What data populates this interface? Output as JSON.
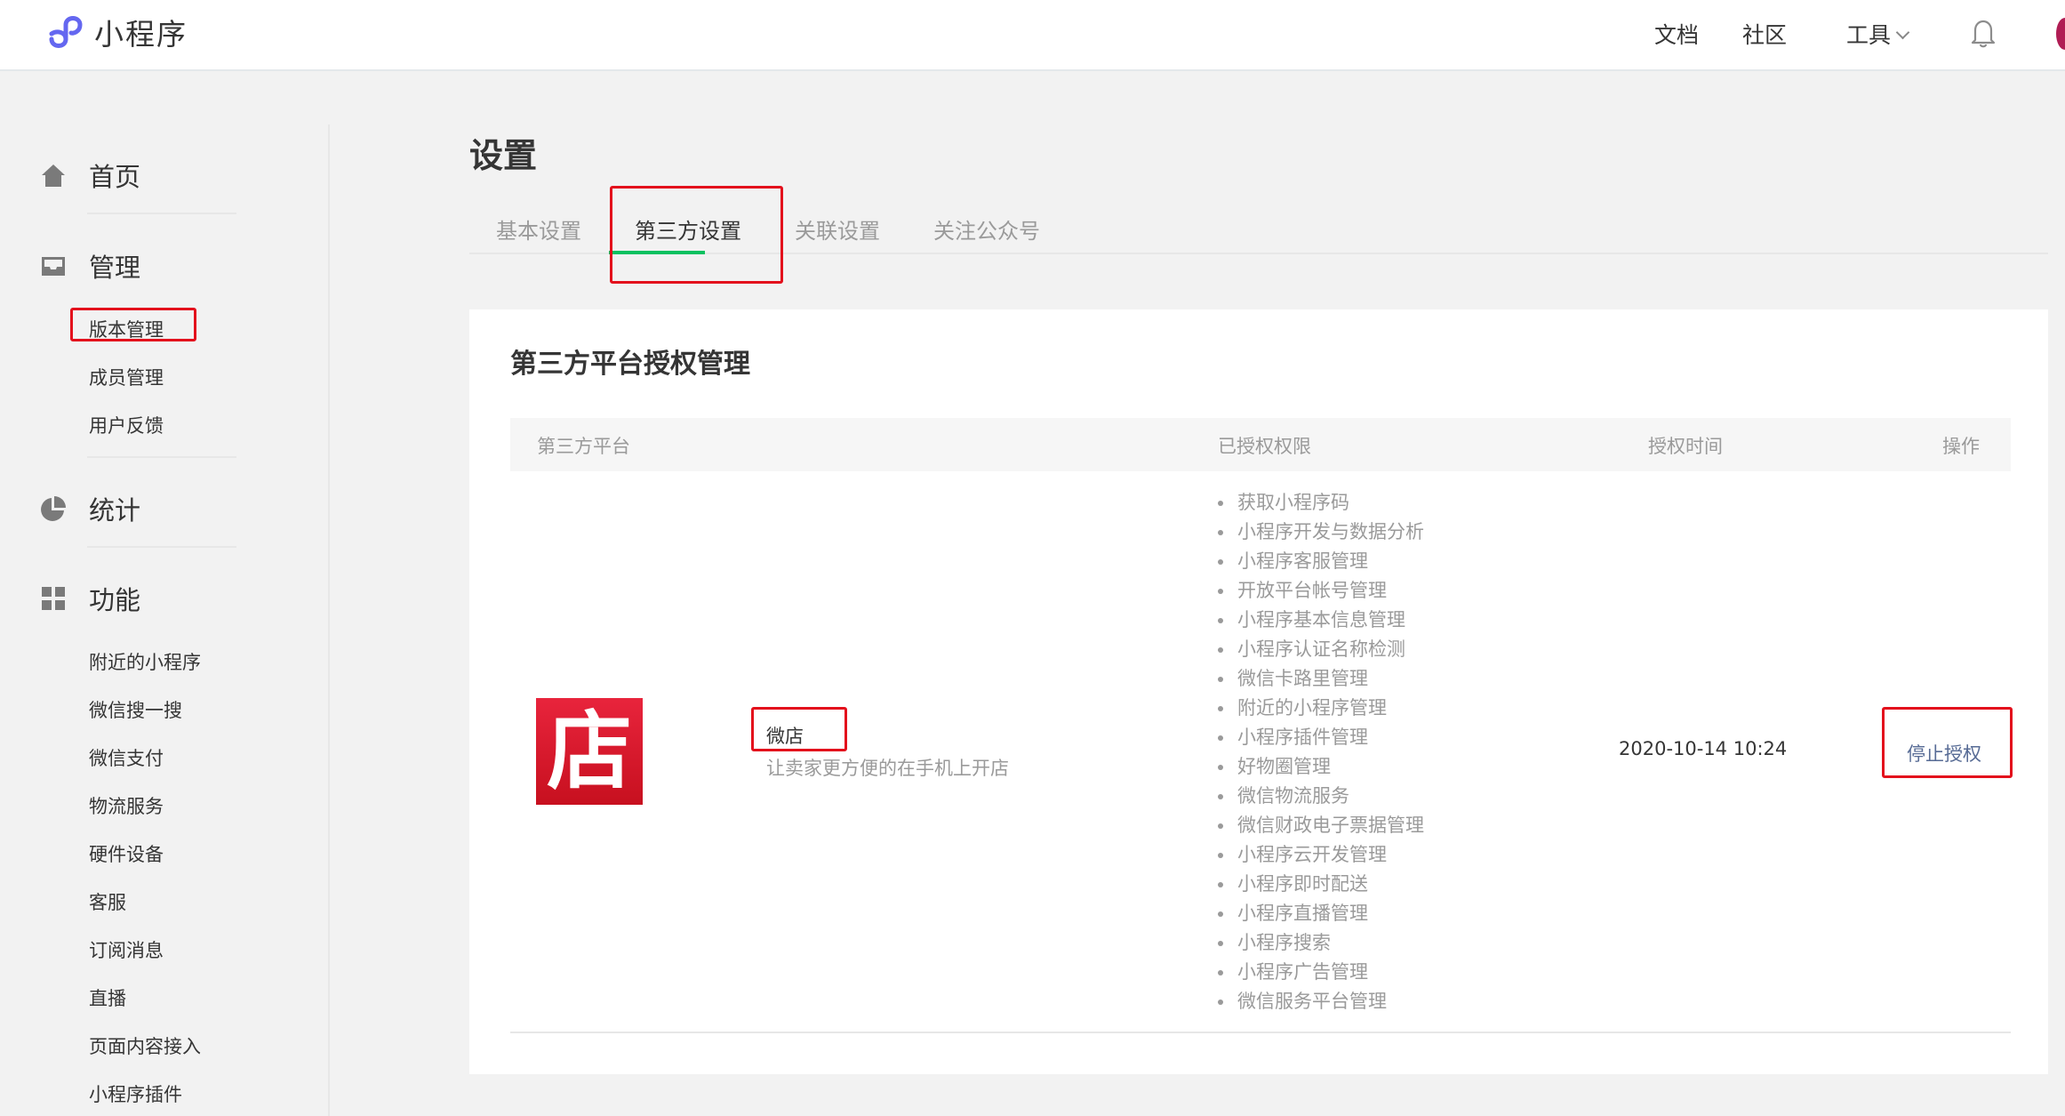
{
  "app": {
    "name": "小程序"
  },
  "topnav": {
    "docs": "文档",
    "community": "社区",
    "tools": "工具"
  },
  "sidebar": {
    "home": "首页",
    "manage": {
      "label": "管理",
      "items": [
        "版本管理",
        "成员管理",
        "用户反馈"
      ]
    },
    "stats": "统计",
    "features": {
      "label": "功能",
      "items": [
        "附近的小程序",
        "微信搜一搜",
        "微信支付",
        "物流服务",
        "硬件设备",
        "客服",
        "订阅消息",
        "直播",
        "页面内容接入",
        "小程序插件"
      ]
    }
  },
  "page": {
    "title": "设置",
    "tabs": [
      "基本设置",
      "第三方设置",
      "关联设置",
      "关注公众号"
    ],
    "active_tab": "第三方设置"
  },
  "card": {
    "title": "第三方平台授权管理",
    "columns": [
      "第三方平台",
      "已授权权限",
      "授权时间",
      "操作"
    ],
    "row": {
      "logo_char": "店",
      "name": "微店",
      "description": "让卖家更方便的在手机上开店",
      "permissions": [
        "获取小程序码",
        "小程序开发与数据分析",
        "小程序客服管理",
        "开放平台帐号管理",
        "小程序基本信息管理",
        "小程序认证名称检测",
        "微信卡路里管理",
        "附近的小程序管理",
        "小程序插件管理",
        "好物圈管理",
        "微信物流服务",
        "微信财政电子票据管理",
        "小程序云开发管理",
        "小程序即时配送",
        "小程序直播管理",
        "小程序搜索",
        "小程序广告管理",
        "微信服务平台管理"
      ],
      "auth_time": "2020-10-14 10:24",
      "action": "停止授权"
    }
  },
  "colors": {
    "accent_green": "#07c160",
    "link_blue": "#576b95",
    "highlight_red": "#e3101c",
    "logo_red": "#d4192b"
  },
  "icons": [
    "miniprogram-logo-icon",
    "bell-icon",
    "home-icon",
    "inbox-icon",
    "pie-chart-icon",
    "grid-icon",
    "chevron-down-icon"
  ]
}
